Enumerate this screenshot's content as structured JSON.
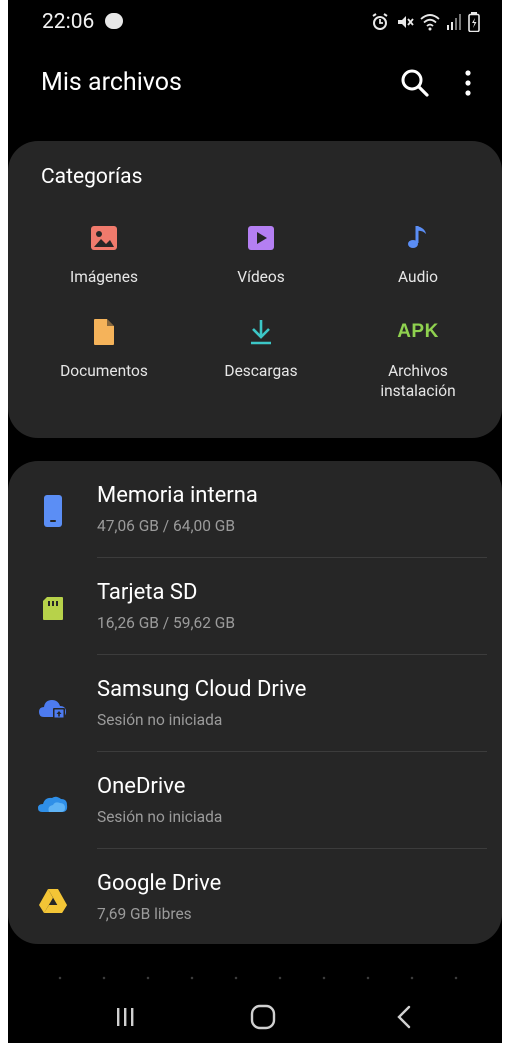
{
  "status_bar": {
    "time": "22:06",
    "icons": [
      "alarm-icon",
      "mute-icon",
      "wifi-icon",
      "signal-icon",
      "battery-icon"
    ]
  },
  "app_bar": {
    "title": "Mis archivos",
    "actions": [
      "search-icon",
      "more-vert-icon"
    ]
  },
  "categories": {
    "title": "Categorías",
    "items": [
      {
        "label": "Imágenes",
        "icon": "image-icon",
        "color": "#f07a6c"
      },
      {
        "label": "Vídeos",
        "icon": "video-icon",
        "color": "#b47ff2"
      },
      {
        "label": "Audio",
        "icon": "music-note-icon",
        "color": "#5b8ef5"
      },
      {
        "label": "Documentos",
        "icon": "document-icon",
        "color": "#f5b35a"
      },
      {
        "label": "Descargas",
        "icon": "download-icon",
        "color": "#3cc7c7"
      },
      {
        "label": "Archivos\ninstalación",
        "icon": "apk-icon",
        "badge": "APK",
        "color": "#8fd14f"
      }
    ]
  },
  "storage": {
    "items": [
      {
        "name": "Memoria interna",
        "sub": "47,06 GB / 64,00 GB",
        "icon": "phone-storage-icon",
        "color": "#5b8ef5"
      },
      {
        "name": "Tarjeta SD",
        "sub": "16,26 GB / 59,62 GB",
        "icon": "sd-card-icon",
        "color": "#b7d24a"
      },
      {
        "name": "Samsung Cloud Drive",
        "sub": "Sesión no iniciada",
        "icon": "samsung-cloud-icon",
        "color": "#4d7bf0"
      },
      {
        "name": "OneDrive",
        "sub": "Sesión no iniciada",
        "icon": "onedrive-icon",
        "color": "#2f8fe8"
      },
      {
        "name": "Google Drive",
        "sub": "7,69 GB libres",
        "icon": "google-drive-icon",
        "color": "#f3c536"
      }
    ]
  },
  "nav_bar": {
    "buttons": [
      "recent-apps-icon",
      "home-icon",
      "back-icon"
    ]
  }
}
